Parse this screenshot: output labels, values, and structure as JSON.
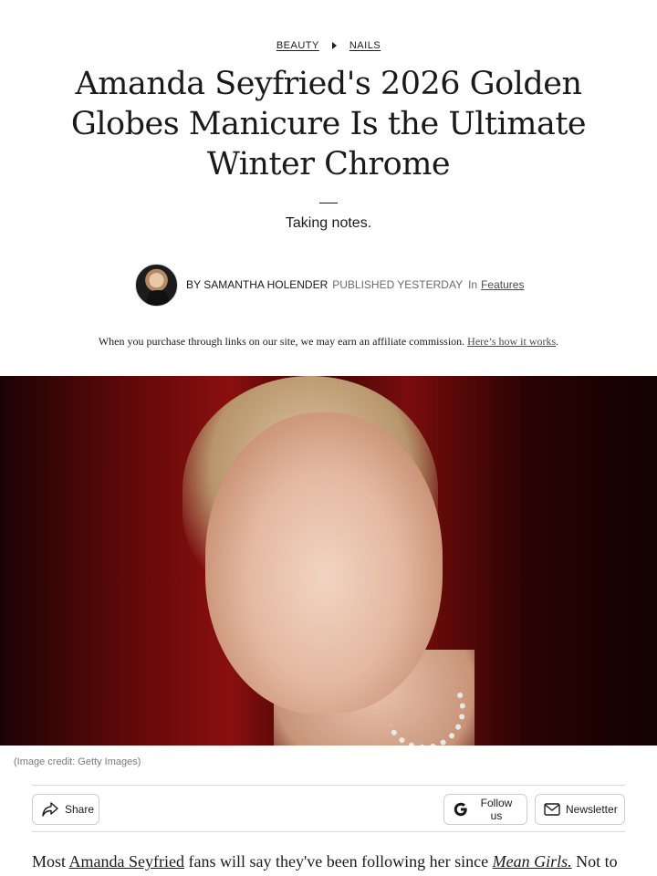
{
  "breadcrumb": {
    "items": [
      "BEAUTY",
      "NAILS"
    ]
  },
  "article": {
    "title": "Amanda Seyfried's 2026 Golden Globes Manicure Is the Ultimate Winter Chrome",
    "subtitle": "Taking notes."
  },
  "byline": {
    "by": "BY",
    "author": "SAMANTHA HOLENDER",
    "published_label": "PUBLISHED",
    "when": "YESTERDAY",
    "in_label": "In",
    "section": "Features"
  },
  "affiliate": {
    "text": "When you purchase through links on our site, we may earn an affiliate commission.",
    "link": "Here’s how it works",
    "period": "."
  },
  "image": {
    "credit": "(Image credit: Getty Images)"
  },
  "actions": {
    "share": "Share",
    "follow": "Follow us",
    "newsletter": "Newsletter"
  },
  "body": {
    "p1_a": "Most ",
    "p1_link": "Amanda Seyfried",
    "p1_b": " fans will say they've been following her since ",
    "p1_em": "Mean Girls.",
    "p1_c": " Not to"
  },
  "icons": {
    "share": "share-arrow-icon",
    "follow": "google-g-icon",
    "newsletter": "envelope-icon",
    "breadcrumb_separator": "triangle-right-icon"
  }
}
